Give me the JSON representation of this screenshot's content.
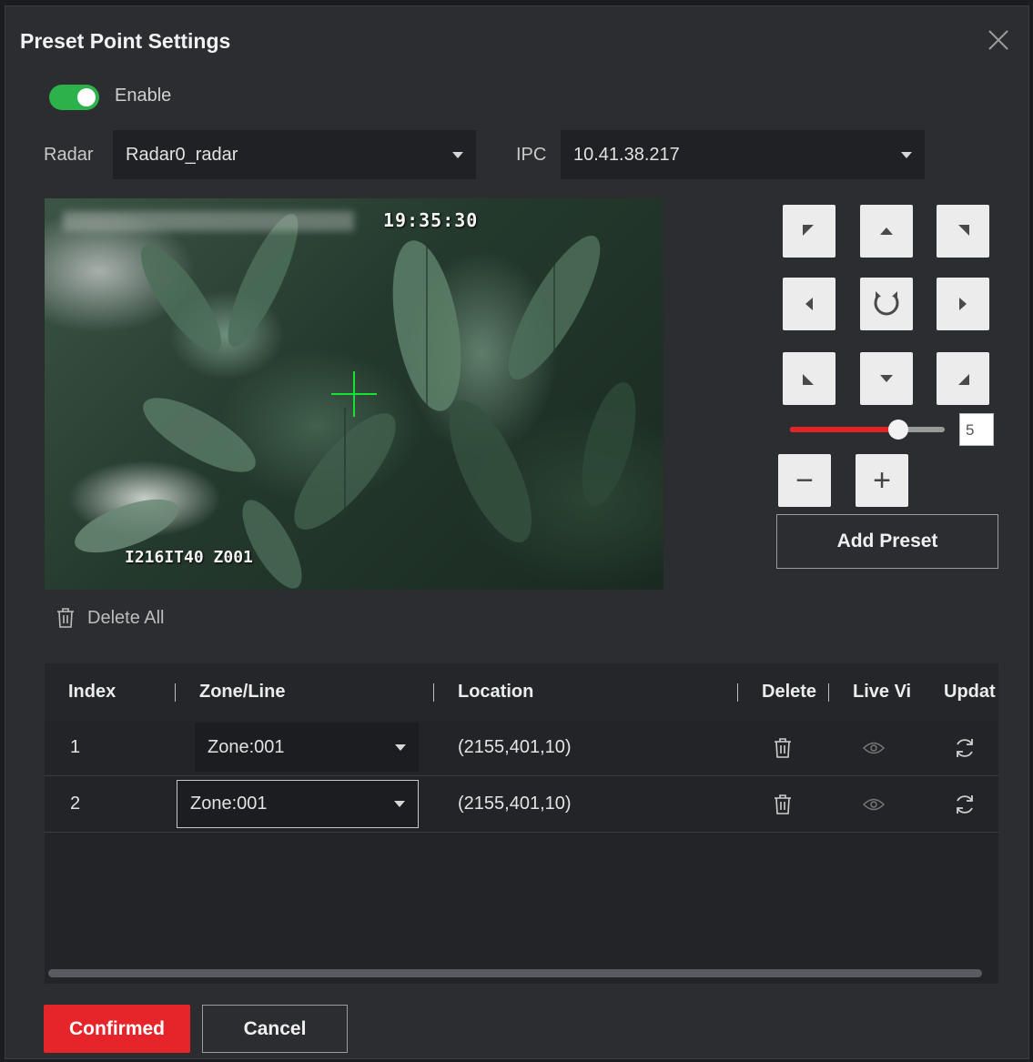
{
  "dialog": {
    "title": "Preset Point Settings",
    "close_icon": "close-icon"
  },
  "enable": {
    "label": "Enable",
    "on": true,
    "color": "#2cb24a"
  },
  "radar": {
    "label": "Radar",
    "value": "Radar0_radar"
  },
  "ipc": {
    "label": "IPC",
    "value": "10.41.38.217"
  },
  "video": {
    "time": "19:35:30",
    "channel_id": "I216IT40  Z001"
  },
  "ptz": {
    "buttons": [
      "up-left",
      "up",
      "up-right",
      "left",
      "refresh",
      "right",
      "down-left",
      "down",
      "down-right"
    ],
    "speed": "5",
    "speed_fraction": 0.7,
    "zoom_out": "−",
    "zoom_in": "+"
  },
  "add_preset_label": "Add Preset",
  "delete_all_label": "Delete All",
  "table": {
    "headers": [
      "Index",
      "Zone/Line",
      "Location",
      "Delete",
      "Live Vi",
      "Updat"
    ],
    "rows": [
      {
        "index": "1",
        "zone": "Zone:001",
        "location": "(2155,401,10)"
      },
      {
        "index": "2",
        "zone": "Zone:001",
        "location": "(2155,401,10)"
      }
    ]
  },
  "footer": {
    "confirm_label": "Confirmed",
    "cancel_label": "Cancel"
  },
  "colors": {
    "accent": "#e6252b",
    "toggle_on": "#2cb24a",
    "background": "#2b2d31"
  }
}
